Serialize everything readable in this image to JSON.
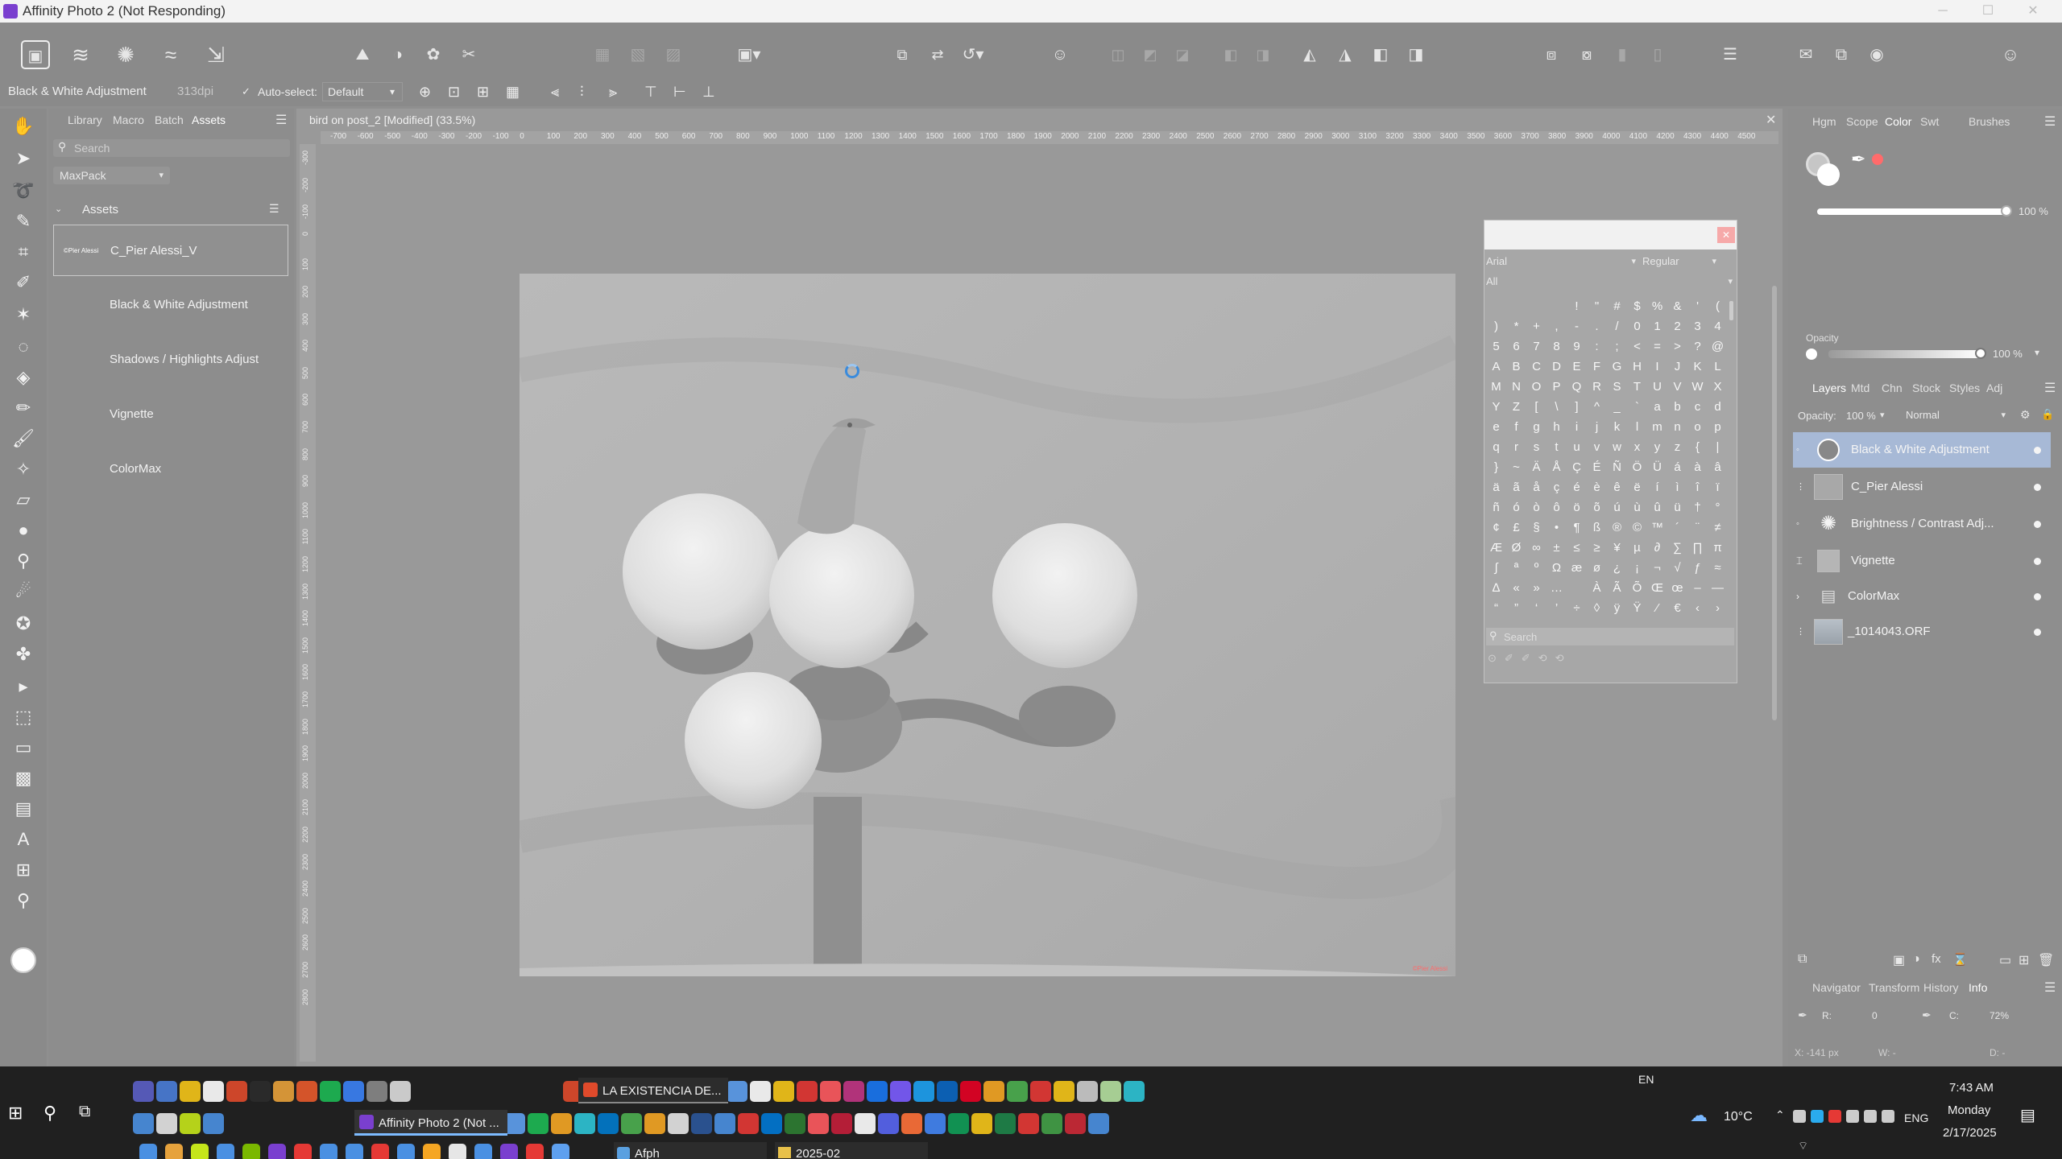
{
  "window": {
    "title": "Affinity Photo 2 (Not Responding)"
  },
  "context_bar": {
    "layer_type": "Black & White Adjustment",
    "dpi": "313dpi",
    "auto_select_label": "Auto-select:",
    "auto_select_value": "Default"
  },
  "assets_panel": {
    "tabs": [
      "Library",
      "Macro",
      "Batch",
      "Assets"
    ],
    "search_placeholder": "Search",
    "category": "MaxPack",
    "section_title": "Assets",
    "items": [
      {
        "thumb_text": "©Pier Alessi",
        "label": "C_Pier Alessi_V"
      },
      {
        "label": "Black & White Adjustment"
      },
      {
        "label": "Shadows / Highlights Adjust"
      },
      {
        "label": "Vignette"
      },
      {
        "label": "ColorMax"
      }
    ]
  },
  "document": {
    "tab_title": "bird on post_2 [Modified] (33.5%)",
    "ruler_ticks": [
      "-700",
      "-600",
      "-500",
      "-400",
      "-300",
      "-200",
      "-100",
      "0",
      "100",
      "200",
      "300",
      "400",
      "500",
      "600",
      "700",
      "800",
      "900",
      "1000",
      "1100",
      "1200",
      "1300",
      "1400",
      "1500",
      "1600",
      "1700",
      "1800",
      "1900",
      "2000",
      "2100",
      "2200",
      "2300",
      "2400",
      "2500",
      "2600",
      "2700",
      "2800",
      "2900",
      "3000",
      "3100",
      "3200",
      "3300",
      "3400",
      "3500",
      "3600",
      "3700",
      "3800",
      "3900",
      "4000",
      "4100",
      "4200",
      "4300",
      "4400",
      "4500"
    ],
    "vruler_ticks": [
      "-300",
      "-200",
      "-100",
      "0",
      "100",
      "200",
      "300",
      "400",
      "500",
      "600",
      "700",
      "800",
      "900",
      "1000",
      "1100",
      "1200",
      "1300",
      "1400",
      "1500",
      "1600",
      "1700",
      "1800",
      "1900",
      "2000",
      "2100",
      "2200",
      "2300",
      "2400",
      "2500",
      "2600",
      "2700",
      "2800"
    ],
    "watermark": "©Pier Alessi"
  },
  "glyph_browser": {
    "font": "Arial",
    "style": "Regular",
    "subset": "All",
    "search_placeholder": "Search",
    "rows": [
      [
        "",
        "",
        "",
        "",
        "!",
        "\"",
        "#",
        "$",
        "%",
        "&",
        "'",
        "("
      ],
      [
        ")",
        "*",
        "+",
        ",",
        "-",
        ".",
        "/",
        "0",
        "1",
        "2",
        "3",
        "4"
      ],
      [
        "5",
        "6",
        "7",
        "8",
        "9",
        ":",
        ";",
        "<",
        "=",
        ">",
        "?",
        "@"
      ],
      [
        "A",
        "B",
        "C",
        "D",
        "E",
        "F",
        "G",
        "H",
        "I",
        "J",
        "K",
        "L"
      ],
      [
        "M",
        "N",
        "O",
        "P",
        "Q",
        "R",
        "S",
        "T",
        "U",
        "V",
        "W",
        "X"
      ],
      [
        "Y",
        "Z",
        "[",
        "\\",
        "]",
        "^",
        "_",
        "`",
        "a",
        "b",
        "c",
        "d"
      ],
      [
        "e",
        "f",
        "g",
        "h",
        "i",
        "j",
        "k",
        "l",
        "m",
        "n",
        "o",
        "p"
      ],
      [
        "q",
        "r",
        "s",
        "t",
        "u",
        "v",
        "w",
        "x",
        "y",
        "z",
        "{",
        "|"
      ],
      [
        "}",
        "~",
        "Ä",
        "Å",
        "Ç",
        "É",
        "Ñ",
        "Ö",
        "Ü",
        "á",
        "à",
        "â"
      ],
      [
        "ä",
        "ã",
        "å",
        "ç",
        "é",
        "è",
        "ê",
        "ë",
        "í",
        "ì",
        "î",
        "ï"
      ],
      [
        "ñ",
        "ó",
        "ò",
        "ô",
        "ö",
        "õ",
        "ú",
        "ù",
        "û",
        "ü",
        "†",
        "°"
      ],
      [
        "¢",
        "£",
        "§",
        "•",
        "¶",
        "ß",
        "®",
        "©",
        "™",
        "´",
        "¨",
        "≠"
      ],
      [
        "Æ",
        "Ø",
        "∞",
        "±",
        "≤",
        "≥",
        "¥",
        "µ",
        "∂",
        "∑",
        "∏",
        "π"
      ],
      [
        "∫",
        "ª",
        "º",
        "Ω",
        "æ",
        "ø",
        "¿",
        "¡",
        "¬",
        "√",
        "ƒ",
        "≈"
      ],
      [
        "∆",
        "«",
        "»",
        "…",
        " ",
        "À",
        "Ã",
        "Õ",
        "Œ",
        "œ",
        "–",
        "—"
      ],
      [
        "“",
        "”",
        "‘",
        "’",
        "÷",
        "◊",
        "ÿ",
        "Ÿ",
        "⁄",
        "€",
        "‹",
        "›"
      ]
    ]
  },
  "right_panel": {
    "color_tabs": [
      "Hgm",
      "Scope",
      "Color",
      "Swt",
      "Brushes"
    ],
    "color_slider_value": "100 %",
    "opacity_label": "Opacity",
    "opacity_value": "100 %",
    "layer_tabs": [
      "Layers",
      "Mtd",
      "Chn",
      "Stock",
      "Styles",
      "Adj"
    ],
    "layers_opacity_label": "Opacity:",
    "layers_opacity_value": "100 %",
    "blend_mode": "Normal",
    "layers": [
      {
        "name": "Black & White Adjustment"
      },
      {
        "name": "C_Pier Alessi"
      },
      {
        "name": "Brightness / Contrast Adj..."
      },
      {
        "name": "Vignette"
      },
      {
        "name": "ColorMax"
      },
      {
        "name": "_1014043.ORF"
      }
    ],
    "bottom_tabs": [
      "Navigator",
      "Transform",
      "History",
      "Info"
    ],
    "info": {
      "r": "R:",
      "r_val": "0",
      "c": "C:",
      "c_val": "72%",
      "x": "X: -141 px",
      "w": "W: -",
      "d": "D: -"
    }
  },
  "taskbar": {
    "pinned_tab_1": "LA EXISTENCIA DE...",
    "app_tab": "Affinity Photo 2 (Not ...",
    "afph_tab": "Afph",
    "folder_tab": "2025-02",
    "lang_top": "EN",
    "weather": "10°C",
    "lang": "ENG",
    "time": "7:43 AM",
    "day": "Monday",
    "date": "2/17/2025"
  },
  "colors": {
    "accent_purple": "#7a3fcf",
    "selection_blue": "#3a8bdc",
    "swatch_red": "#ff6b6b"
  }
}
